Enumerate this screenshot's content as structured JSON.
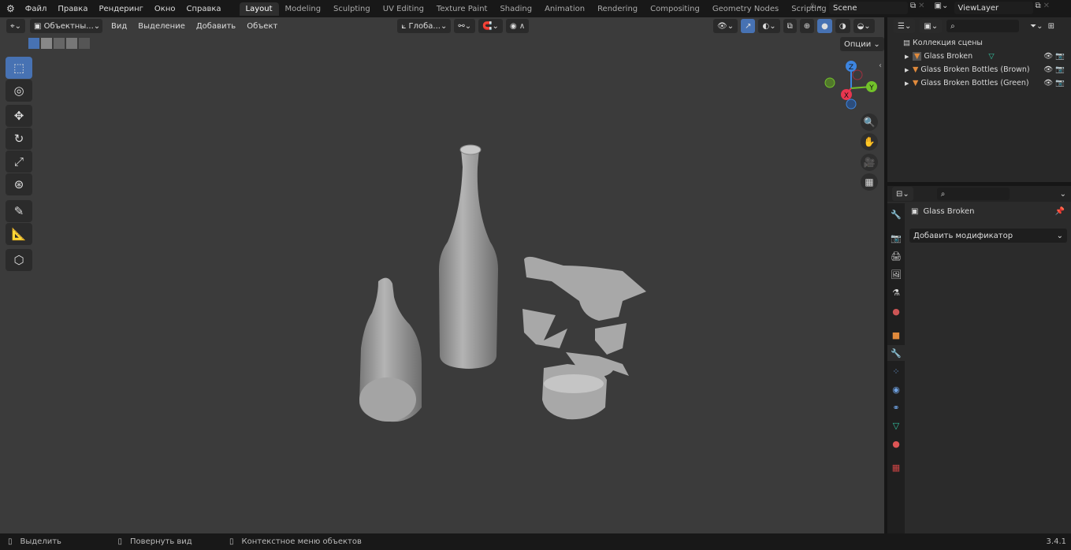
{
  "topbar": {
    "menus": [
      "Файл",
      "Правка",
      "Рендеринг",
      "Окно",
      "Справка"
    ],
    "workspaces": [
      "Layout",
      "Modeling",
      "Sculpting",
      "UV Editing",
      "Texture Paint",
      "Shading",
      "Animation",
      "Rendering",
      "Compositing",
      "Geometry Nodes",
      "Scripting"
    ],
    "active_workspace": "Layout",
    "add_workspace": "+",
    "scene": "Scene",
    "view_layer": "ViewLayer"
  },
  "viewport_header": {
    "mode": "Объектны...",
    "menus": [
      "Вид",
      "Выделение",
      "Добавить",
      "Объект"
    ],
    "orientation": "Глоба...",
    "options": "Опции"
  },
  "gizmo": {
    "x": "X",
    "y": "Y",
    "z": "Z",
    "colors": {
      "x": "#e8364f",
      "y": "#72c22a",
      "z": "#3d85e0"
    }
  },
  "outliner": {
    "collection": "Коллекция сцены",
    "items": [
      "Glass Broken",
      "Glass Broken Bottles (Brown)",
      "Glass Broken Bottles (Green)"
    ]
  },
  "properties": {
    "object": "Glass Broken",
    "add_modifier": "Добавить модификатор"
  },
  "status": {
    "select": "Выделить",
    "rotate": "Повернуть вид",
    "context": "Контекстное меню объектов",
    "version": "3.4.1"
  }
}
